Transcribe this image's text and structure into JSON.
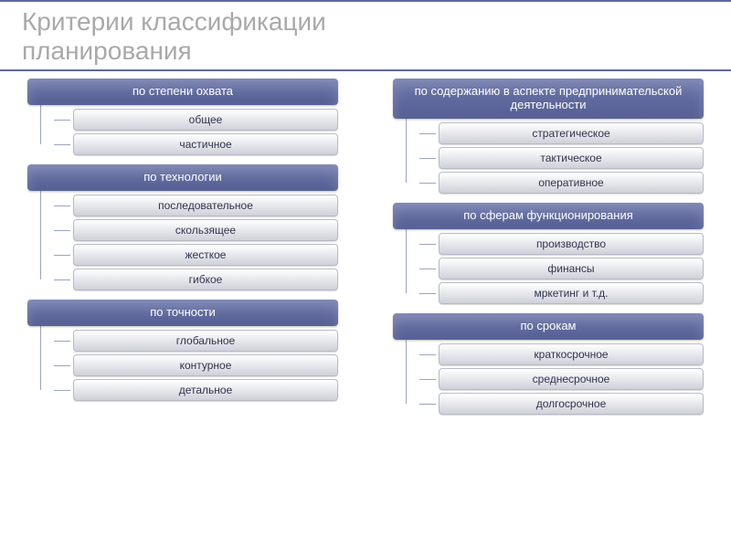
{
  "title_line1": "Критерии классификации",
  "title_line2": "планирования",
  "left": [
    {
      "header": "по степени охвата",
      "items": [
        "общее",
        "частичное"
      ]
    },
    {
      "header": "по технологии",
      "items": [
        "последовательное",
        "скользящее",
        "жесткое",
        "гибкое"
      ]
    },
    {
      "header": "по точности",
      "items": [
        "глобальное",
        "контурное",
        "детальное"
      ]
    }
  ],
  "right": [
    {
      "header": "по содержанию в аспекте предпринимательской деятельности",
      "items": [
        "стратегическое",
        "тактическое",
        "оперативное"
      ]
    },
    {
      "header": "по сферам функционирования",
      "items": [
        "производство",
        "финансы",
        "мркетинг и т.д."
      ]
    },
    {
      "header": "по срокам",
      "items": [
        "краткосрочное",
        "среднесрочное",
        "долгосрочное"
      ]
    }
  ]
}
